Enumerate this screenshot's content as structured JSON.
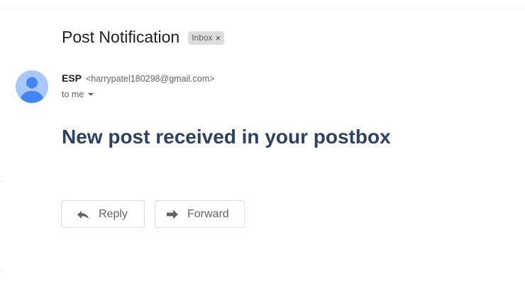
{
  "message": {
    "subject": "Post Notification",
    "label": {
      "text": "Inbox",
      "remove_glyph": "×"
    },
    "sender": {
      "name": "ESP",
      "email": "<harrypatel180298@gmail.com>"
    },
    "recipient_line": "to me",
    "body_heading": "New post received in your postbox"
  },
  "actions": {
    "reply_label": "Reply",
    "forward_label": "Forward"
  },
  "icons": {
    "avatar": "person-icon",
    "reply": "reply-arrow-icon",
    "forward": "forward-arrow-icon",
    "recipients": "chevron-down-icon",
    "label_remove": "close-icon"
  },
  "colors": {
    "body_heading": "#2e4063",
    "avatar_bg": "#a8c7fa",
    "avatar_fg": "#4285f4",
    "label_chip_bg": "#dddddd",
    "button_border": "#dadce0"
  }
}
